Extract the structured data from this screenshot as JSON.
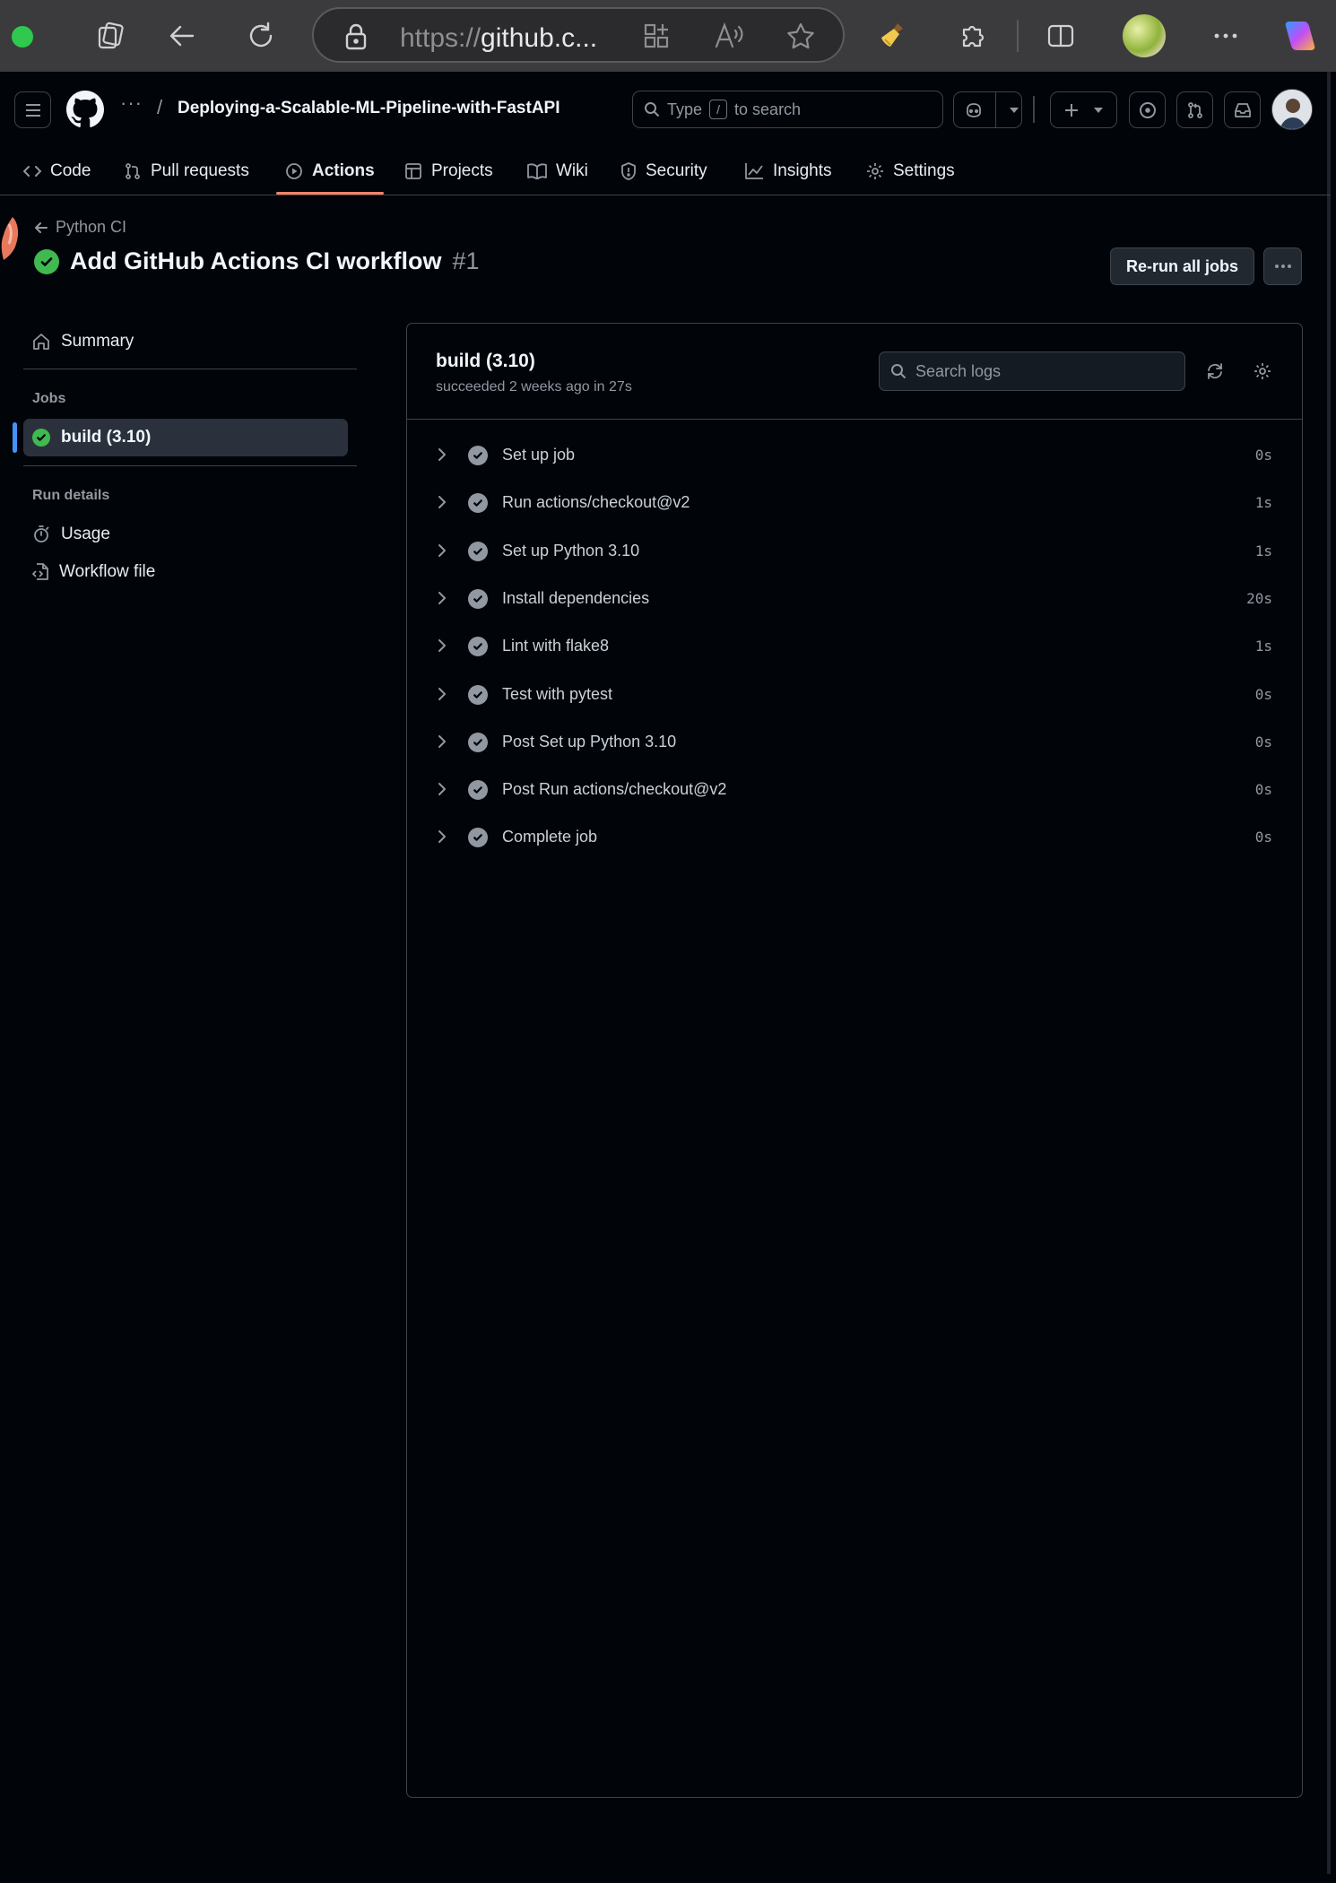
{
  "browser": {
    "url_scheme": "https://",
    "url_host": "github.c..."
  },
  "repo": {
    "ellipsis": "···",
    "separator": "/",
    "name": "Deploying-a-Scalable-ML-Pipeline-with-FastAPI"
  },
  "search": {
    "prefix": "Type",
    "key": "/",
    "suffix": "to search"
  },
  "tabs": [
    {
      "label": "Code"
    },
    {
      "label": "Pull requests"
    },
    {
      "label": "Actions"
    },
    {
      "label": "Projects"
    },
    {
      "label": "Wiki"
    },
    {
      "label": "Security"
    },
    {
      "label": "Insights"
    },
    {
      "label": "Settings"
    }
  ],
  "header": {
    "back_label": "Python CI",
    "title": "Add GitHub Actions CI workflow",
    "run_number": "#1",
    "rerun_label": "Re-run all jobs"
  },
  "sidebar": {
    "summary_label": "Summary",
    "jobs_heading": "Jobs",
    "job_label": "build (3.10)",
    "run_details_heading": "Run details",
    "usage_label": "Usage",
    "workflow_file_label": "Workflow file"
  },
  "job": {
    "title": "build (3.10)",
    "subtitle": "succeeded 2 weeks ago in 27s",
    "search_placeholder": "Search logs",
    "steps": [
      {
        "name": "Set up job",
        "time": "0s"
      },
      {
        "name": "Run actions/checkout@v2",
        "time": "1s"
      },
      {
        "name": "Set up Python 3.10",
        "time": "1s"
      },
      {
        "name": "Install dependencies",
        "time": "20s"
      },
      {
        "name": "Lint with flake8",
        "time": "1s"
      },
      {
        "name": "Test with pytest",
        "time": "0s"
      },
      {
        "name": "Post Set up Python 3.10",
        "time": "0s"
      },
      {
        "name": "Post Run actions/checkout@v2",
        "time": "0s"
      },
      {
        "name": "Complete job",
        "time": "0s"
      }
    ]
  },
  "colors": {
    "success": "#3fb950",
    "accent_underline": "#f78166",
    "active_bar": "#4493f8"
  }
}
